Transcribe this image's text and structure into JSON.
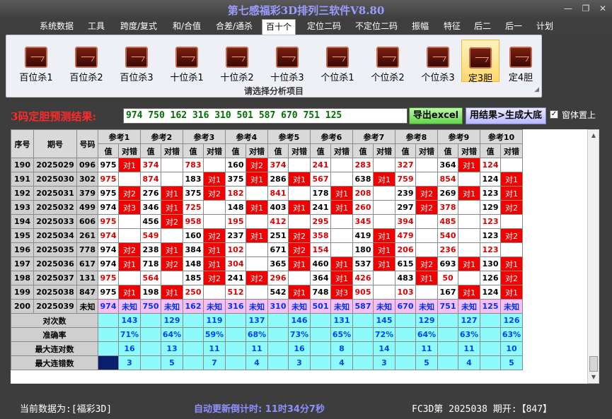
{
  "window": {
    "title": "第七感福彩3D排列三软件V8.80",
    "minimize": "—",
    "restore": "❐",
    "close": "✕"
  },
  "menu": [
    "系统数据",
    "工具",
    "跨度/复式",
    "和/合值",
    "合差/通杀",
    "百十个",
    "定位二码",
    "不定位二码",
    "振幅",
    "特征",
    "后二",
    "后一",
    "计划"
  ],
  "menu_active": "百十个",
  "ribbon": {
    "buttons": [
      "百位杀1",
      "百位杀2",
      "百位杀3",
      "十位杀1",
      "十位杀2",
      "十位杀3",
      "个位杀1",
      "个位杀2",
      "个位杀3",
      "定3胆",
      "定4胆"
    ],
    "active": "定3胆",
    "caption": "请选择分析项目"
  },
  "result": {
    "label": "3码定胆预测结果:",
    "value": "974  750  162  316  310  501  587  670  751  125",
    "export_button": "导出excel",
    "generate_button": "用结果>生成大底",
    "topmost_label": "窗体置上",
    "topmost_checked": "✓"
  },
  "table": {
    "headers": {
      "seq": "序号",
      "period": "期号",
      "number": "号码",
      "groups": [
        "参考1",
        "参考2",
        "参考3",
        "参考4",
        "参考5",
        "参考6",
        "参考7",
        "参考8",
        "参考9",
        "参考10"
      ],
      "sub_value": "值",
      "sub_mark": "对错"
    },
    "rows": [
      {
        "seq": "190",
        "period": "2025029",
        "number": "096",
        "cells": [
          [
            "975",
            "对1"
          ],
          [
            "374",
            ""
          ],
          [
            "783",
            ""
          ],
          [
            "160",
            "对2"
          ],
          [
            "374",
            ""
          ],
          [
            "241",
            ""
          ],
          [
            "283",
            ""
          ],
          [
            "327",
            ""
          ],
          [
            "364",
            "对1"
          ],
          [
            "124",
            ""
          ]
        ]
      },
      {
        "seq": "191",
        "period": "2025030",
        "number": "302",
        "cells": [
          [
            "975",
            ""
          ],
          [
            "874",
            ""
          ],
          [
            "183",
            "对1"
          ],
          [
            "375",
            "对1"
          ],
          [
            "286",
            "对1"
          ],
          [
            "567",
            ""
          ],
          [
            "638",
            "对1"
          ],
          [
            "759",
            ""
          ],
          [
            "854",
            ""
          ],
          [
            "124",
            "对1"
          ]
        ]
      },
      {
        "seq": "192",
        "period": "2025031",
        "number": "379",
        "cells": [
          [
            "975",
            "对2"
          ],
          [
            "276",
            "对1"
          ],
          [
            "375",
            "对2"
          ],
          [
            "182",
            ""
          ],
          [
            "841",
            ""
          ],
          [
            "178",
            "对1"
          ],
          [
            "208",
            ""
          ],
          [
            "239",
            "对2"
          ],
          [
            "269",
            "对1"
          ],
          [
            "123",
            "对1"
          ]
        ]
      },
      {
        "seq": "193",
        "period": "2025032",
        "number": "499",
        "cells": [
          [
            "974",
            "对3"
          ],
          [
            "346",
            "对1"
          ],
          [
            "725",
            ""
          ],
          [
            "148",
            "对1"
          ],
          [
            "403",
            "对1"
          ],
          [
            "241",
            "对1"
          ],
          [
            "260",
            ""
          ],
          [
            "297",
            "对2"
          ],
          [
            "378",
            ""
          ],
          [
            "129",
            "对2"
          ]
        ]
      },
      {
        "seq": "194",
        "period": "2025033",
        "number": "606",
        "cells": [
          [
            "975",
            ""
          ],
          [
            "456",
            "对2"
          ],
          [
            "958",
            ""
          ],
          [
            "195",
            ""
          ],
          [
            "412",
            ""
          ],
          [
            "295",
            ""
          ],
          [
            "345",
            ""
          ],
          [
            "394",
            ""
          ],
          [
            "485",
            ""
          ],
          [
            "123",
            ""
          ]
        ]
      },
      {
        "seq": "195",
        "period": "2025034",
        "number": "261",
        "cells": [
          [
            "974",
            ""
          ],
          [
            "549",
            ""
          ],
          [
            "160",
            "对2"
          ],
          [
            "237",
            "对1"
          ],
          [
            "251",
            "对2"
          ],
          [
            "358",
            ""
          ],
          [
            "419",
            "对1"
          ],
          [
            "479",
            ""
          ],
          [
            "540",
            ""
          ],
          [
            "123",
            "对2"
          ]
        ]
      },
      {
        "seq": "196",
        "period": "2025035",
        "number": "778",
        "cells": [
          [
            "974",
            "对2"
          ],
          [
            "238",
            "对1"
          ],
          [
            "384",
            "对1"
          ],
          [
            "102",
            ""
          ],
          [
            "671",
            "对2"
          ],
          [
            "154",
            ""
          ],
          [
            "180",
            "对1"
          ],
          [
            "206",
            ""
          ],
          [
            "236",
            ""
          ],
          [
            "123",
            ""
          ]
        ]
      },
      {
        "seq": "197",
        "period": "2025036",
        "number": "617",
        "cells": [
          [
            "974",
            "对1"
          ],
          [
            "718",
            "对2"
          ],
          [
            "148",
            "对1"
          ],
          [
            "304",
            ""
          ],
          [
            "365",
            "对1"
          ],
          [
            "460",
            "对1"
          ],
          [
            "537",
            "对1"
          ],
          [
            "615",
            "对2"
          ],
          [
            "693",
            "对1"
          ],
          [
            "130",
            "对1"
          ]
        ]
      },
      {
        "seq": "198",
        "period": "2025037",
        "number": "131",
        "cells": [
          [
            "975",
            ""
          ],
          [
            "564",
            ""
          ],
          [
            "185",
            "对2"
          ],
          [
            "241",
            "对2"
          ],
          [
            "296",
            ""
          ],
          [
            "364",
            "对1"
          ],
          [
            "426",
            ""
          ],
          [
            "483",
            "对1"
          ],
          [
            "50",
            ""
          ],
          [
            "126",
            "对2"
          ]
        ]
      },
      {
        "seq": "199",
        "period": "2025038",
        "number": "847",
        "cells": [
          [
            "975",
            "对1"
          ],
          [
            "198",
            "对1"
          ],
          [
            "250",
            ""
          ],
          [
            "512",
            ""
          ],
          [
            "542",
            "对1"
          ],
          [
            "748",
            "对3"
          ],
          [
            "905",
            ""
          ],
          [
            "103",
            ""
          ],
          [
            "167",
            "对1"
          ],
          [
            "124",
            "对1"
          ]
        ]
      }
    ],
    "forecast": {
      "seq": "200",
      "period": "2025039",
      "number": "未知",
      "values": [
        "974",
        "750",
        "162",
        "316",
        "310",
        "501",
        "587",
        "670",
        "751",
        "125"
      ],
      "mark": "未知"
    },
    "stats": [
      {
        "label": "对次数",
        "values": [
          "143",
          "129",
          "119",
          "137",
          "146",
          "131",
          "145",
          "129",
          "127",
          "126"
        ]
      },
      {
        "label": "准确率",
        "values": [
          "71%",
          "64%",
          "59%",
          "68%",
          "73%",
          "65%",
          "72%",
          "64%",
          "63%",
          "63%"
        ]
      },
      {
        "label": "最大连对数",
        "values": [
          "16",
          "13",
          "11",
          "11",
          "16",
          "8",
          "14",
          "11",
          "11",
          "10"
        ]
      },
      {
        "label": "最大连错数",
        "values": [
          "3",
          "5",
          "7",
          "4",
          "3",
          "4",
          "3",
          "5",
          "4",
          "5"
        ]
      }
    ]
  },
  "status": {
    "data_label": "当前数据为:[福彩3D]",
    "countdown": "自动更新倒计时: 11时34分7秒",
    "draw": "FC3D第 2025038 期开:【847】"
  },
  "colors": {
    "hit": "#f20000",
    "miss_value": "#e00000",
    "forecast_row": "#f6c0f6",
    "stats_row": "#8ffafa",
    "title": "#9a9cff",
    "result_label": "#ff2a2a"
  }
}
